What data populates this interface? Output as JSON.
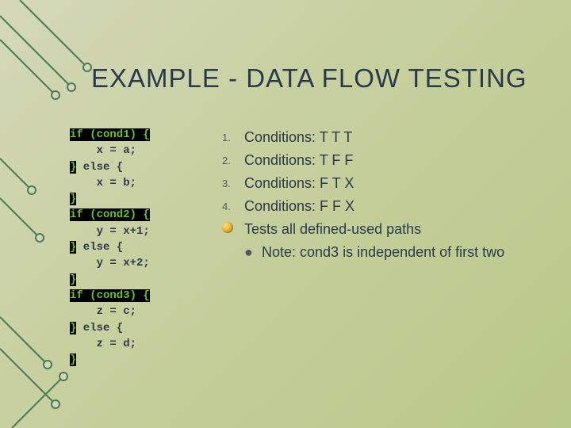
{
  "title": "EXAMPLE - DATA FLOW TESTING",
  "code": {
    "l1": "if (cond1) {",
    "l2": "    x = a;",
    "l3a": "}",
    "l3b": " else {",
    "l4": "    x = b;",
    "l5": "}",
    "l6": "if (cond2) {",
    "l7": "    y = x+1;",
    "l8a": "}",
    "l8b": " else {",
    "l9": "    y = x+2;",
    "l10": "}",
    "l11": "if (cond3) {",
    "l12": "    z = c;",
    "l13a": "}",
    "l13b": " else {",
    "l14": "    z = d;",
    "l15": "}"
  },
  "list": {
    "items": [
      {
        "num": "1.",
        "text": "Conditions: T T T"
      },
      {
        "num": "2.",
        "text": "Conditions: T F F"
      },
      {
        "num": "3.",
        "text": "Conditions: F T X"
      },
      {
        "num": "4.",
        "text": "Conditions: F F X"
      }
    ],
    "bullet_text": "Tests all defined-used paths",
    "sub_bullet": "Note: cond3 is independent of first two"
  }
}
